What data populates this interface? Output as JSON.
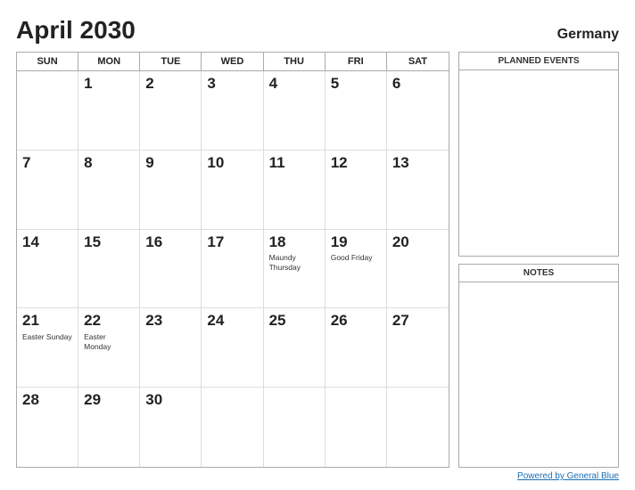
{
  "header": {
    "title": "April 2030",
    "country": "Germany"
  },
  "day_headers": [
    "SUN",
    "MON",
    "TUE",
    "WED",
    "THU",
    "FRI",
    "SAT"
  ],
  "weeks": [
    [
      {
        "day": "",
        "holiday": ""
      },
      {
        "day": "1",
        "holiday": ""
      },
      {
        "day": "2",
        "holiday": ""
      },
      {
        "day": "3",
        "holiday": ""
      },
      {
        "day": "4",
        "holiday": ""
      },
      {
        "day": "5",
        "holiday": ""
      },
      {
        "day": "6",
        "holiday": ""
      }
    ],
    [
      {
        "day": "7",
        "holiday": ""
      },
      {
        "day": "8",
        "holiday": ""
      },
      {
        "day": "9",
        "holiday": ""
      },
      {
        "day": "10",
        "holiday": ""
      },
      {
        "day": "11",
        "holiday": ""
      },
      {
        "day": "12",
        "holiday": ""
      },
      {
        "day": "13",
        "holiday": ""
      }
    ],
    [
      {
        "day": "14",
        "holiday": ""
      },
      {
        "day": "15",
        "holiday": ""
      },
      {
        "day": "16",
        "holiday": ""
      },
      {
        "day": "17",
        "holiday": ""
      },
      {
        "day": "18",
        "holiday": "Maundy Thursday"
      },
      {
        "day": "19",
        "holiday": "Good Friday"
      },
      {
        "day": "20",
        "holiday": ""
      }
    ],
    [
      {
        "day": "21",
        "holiday": "Easter Sunday"
      },
      {
        "day": "22",
        "holiday": "Easter Monday"
      },
      {
        "day": "23",
        "holiday": ""
      },
      {
        "day": "24",
        "holiday": ""
      },
      {
        "day": "25",
        "holiday": ""
      },
      {
        "day": "26",
        "holiday": ""
      },
      {
        "day": "27",
        "holiday": ""
      }
    ],
    [
      {
        "day": "28",
        "holiday": ""
      },
      {
        "day": "29",
        "holiday": ""
      },
      {
        "day": "30",
        "holiday": ""
      },
      {
        "day": "",
        "holiday": ""
      },
      {
        "day": "",
        "holiday": ""
      },
      {
        "day": "",
        "holiday": ""
      },
      {
        "day": "",
        "holiday": ""
      }
    ]
  ],
  "right_panel": {
    "planned_events_label": "PLANNED EVENTS",
    "notes_label": "NOTES"
  },
  "footer": {
    "link_text": "Powered by General Blue"
  }
}
